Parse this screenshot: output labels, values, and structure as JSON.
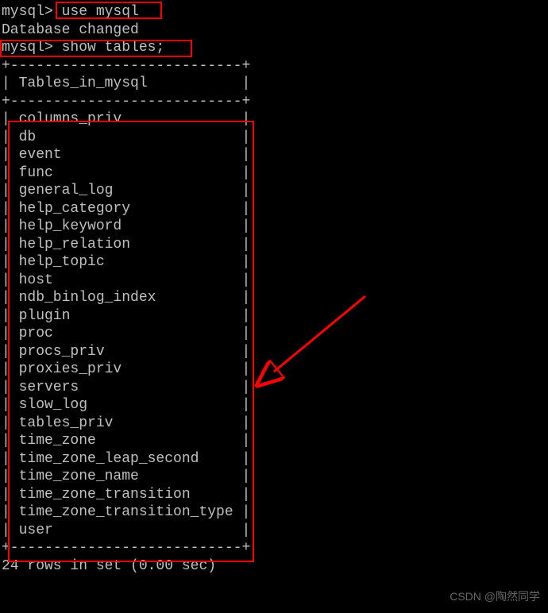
{
  "terminal": {
    "prompt": "mysql>",
    "command1": " use mysql",
    "response1": "Database changed",
    "command2": " show tables;",
    "border_top": "+---------------------------+",
    "header_label": "| Tables_in_mysql           |",
    "border_mid": "+---------------------------+",
    "rows": [
      "| columns_priv              |",
      "| db                        |",
      "| event                     |",
      "| func                      |",
      "| general_log               |",
      "| help_category             |",
      "| help_keyword              |",
      "| help_relation             |",
      "| help_topic                |",
      "| host                      |",
      "| ndb_binlog_index          |",
      "| plugin                    |",
      "| proc                      |",
      "| procs_priv                |",
      "| proxies_priv              |",
      "| servers                   |",
      "| slow_log                  |",
      "| tables_priv               |",
      "| time_zone                 |",
      "| time_zone_leap_second     |",
      "| time_zone_name            |",
      "| time_zone_transition      |",
      "| time_zone_transition_type |",
      "| user                      |"
    ],
    "border_bot": "+---------------------------+",
    "footer": "24 rows in set (0.00 sec)"
  },
  "watermark_faint": "",
  "watermark": "CSDN @陶然同学"
}
